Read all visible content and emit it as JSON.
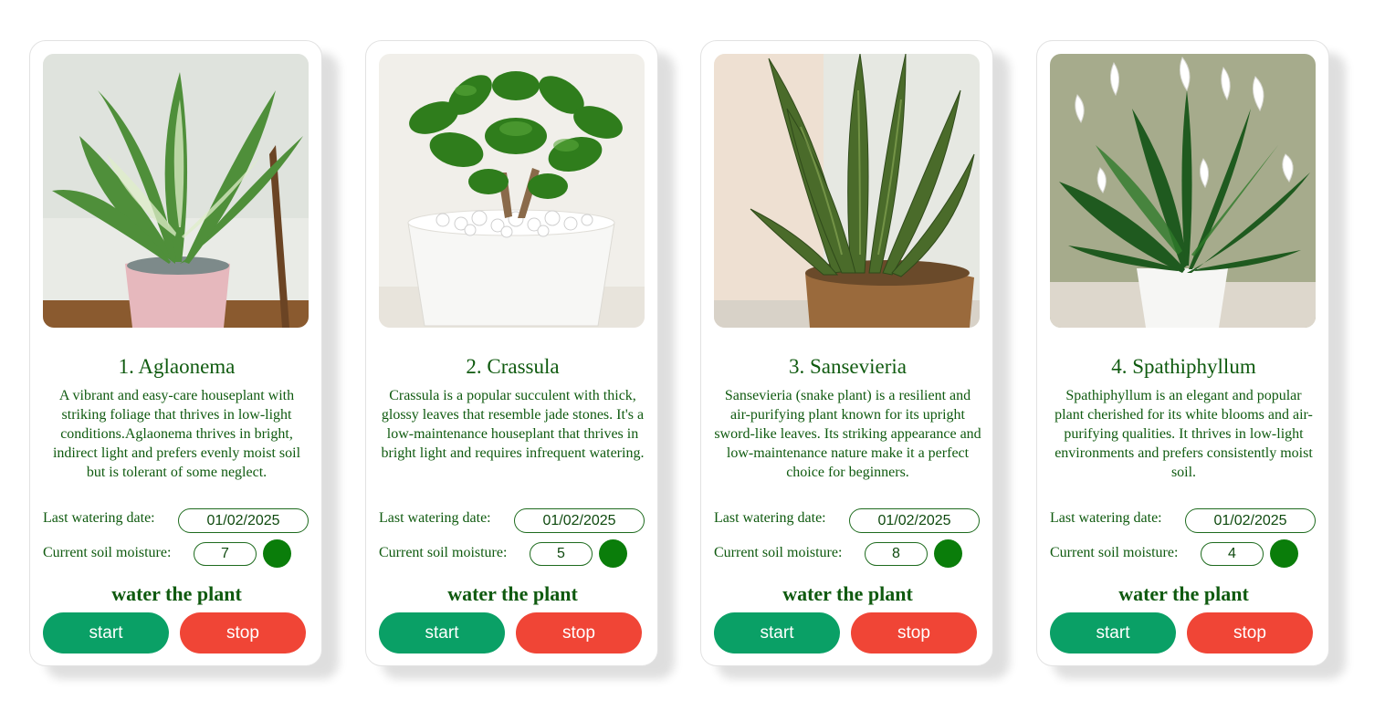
{
  "colors": {
    "text": "#0f5a0f",
    "start_button": "#0aa066",
    "stop_button": "#f04536",
    "status_dot": "#0a7d0a"
  },
  "labels": {
    "last_watering": "Last watering date:",
    "soil_moisture": "Current soil moisture:",
    "water": "water the plant",
    "start": "start",
    "stop": "stop"
  },
  "plants": [
    {
      "title": "1. Aglaonema",
      "description": "A vibrant and easy-care houseplant with striking foliage that thrives in low-light conditions.Aglaonema thrives in bright, indirect light and prefers evenly moist soil but is tolerant of some neglect.",
      "last_watering": "01/02/2025",
      "moisture": "7",
      "image": "aglaonema-photo"
    },
    {
      "title": "2. Crassula",
      "description": "Crassula is a popular succulent with thick, glossy leaves that resemble jade stones. It's a low-maintenance houseplant that thrives in bright light and requires infrequent watering.",
      "last_watering": "01/02/2025",
      "moisture": "5",
      "image": "crassula-photo"
    },
    {
      "title": "3. Sansevieria",
      "description": "Sansevieria (snake plant) is a resilient and air-purifying plant known for its upright sword-like leaves. Its striking appearance and low-maintenance nature make it a perfect choice for beginners.",
      "last_watering": "01/02/2025",
      "moisture": "8",
      "image": "sansevieria-photo"
    },
    {
      "title": "4. Spathiphyllum",
      "description": "Spathiphyllum is an elegant and popular plant cherished for its white blooms and air-purifying qualities. It thrives in low-light environments and prefers consistently moist soil.",
      "last_watering": "01/02/2025",
      "moisture": "4",
      "image": "spathiphyllum-photo"
    }
  ]
}
